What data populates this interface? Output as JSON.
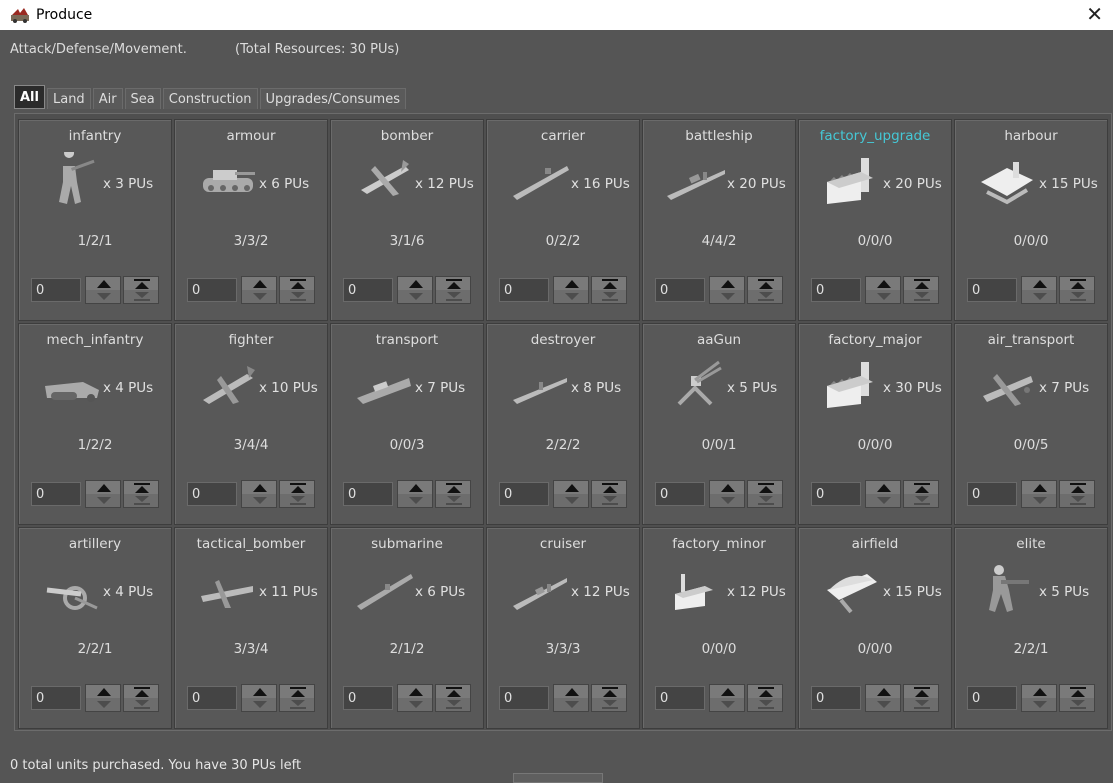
{
  "window": {
    "title": "Produce"
  },
  "header": {
    "info_label": "Attack/Defense/Movement.",
    "resources_label": "(Total Resources: 30 PUs)"
  },
  "tabs": [
    {
      "label": "All",
      "active": true
    },
    {
      "label": "Land"
    },
    {
      "label": "Air"
    },
    {
      "label": "Sea"
    },
    {
      "label": "Construction"
    },
    {
      "label": "Upgrades/Consumes"
    }
  ],
  "units": [
    {
      "name": "infantry",
      "cost": "x 3 PUs",
      "stats": "1/2/1",
      "qty": "0",
      "icon": "infantry-icon"
    },
    {
      "name": "armour",
      "cost": "x 6 PUs",
      "stats": "3/3/2",
      "qty": "0",
      "icon": "tank-icon"
    },
    {
      "name": "bomber",
      "cost": "x 12 PUs",
      "stats": "3/1/6",
      "qty": "0",
      "icon": "bomber-icon"
    },
    {
      "name": "carrier",
      "cost": "x 16 PUs",
      "stats": "0/2/2",
      "qty": "0",
      "icon": "carrier-icon"
    },
    {
      "name": "battleship",
      "cost": "x 20 PUs",
      "stats": "4/4/2",
      "qty": "0",
      "icon": "battleship-icon"
    },
    {
      "name": "factory_upgrade",
      "cost": "x 20 PUs",
      "stats": "0/0/0",
      "qty": "0",
      "icon": "factory-icon",
      "highlight": true
    },
    {
      "name": "harbour",
      "cost": "x 15 PUs",
      "stats": "0/0/0",
      "qty": "0",
      "icon": "harbour-icon"
    },
    {
      "name": "mech_infantry",
      "cost": "x 4 PUs",
      "stats": "1/2/2",
      "qty": "0",
      "icon": "halftrack-icon"
    },
    {
      "name": "fighter",
      "cost": "x 10 PUs",
      "stats": "3/4/4",
      "qty": "0",
      "icon": "fighter-icon"
    },
    {
      "name": "transport",
      "cost": "x 7 PUs",
      "stats": "0/0/3",
      "qty": "0",
      "icon": "transport-ship-icon"
    },
    {
      "name": "destroyer",
      "cost": "x 8 PUs",
      "stats": "2/2/2",
      "qty": "0",
      "icon": "destroyer-icon"
    },
    {
      "name": "aaGun",
      "cost": "x 5 PUs",
      "stats": "0/0/1",
      "qty": "0",
      "icon": "aa-gun-icon"
    },
    {
      "name": "factory_major",
      "cost": "x 30 PUs",
      "stats": "0/0/0",
      "qty": "0",
      "icon": "factory-icon"
    },
    {
      "name": "air_transport",
      "cost": "x 7 PUs",
      "stats": "0/0/5",
      "qty": "0",
      "icon": "air-transport-icon"
    },
    {
      "name": "artillery",
      "cost": "x 4 PUs",
      "stats": "2/2/1",
      "qty": "0",
      "icon": "artillery-icon"
    },
    {
      "name": "tactical_bomber",
      "cost": "x 11 PUs",
      "stats": "3/3/4",
      "qty": "0",
      "icon": "tactical-bomber-icon"
    },
    {
      "name": "submarine",
      "cost": "x 6 PUs",
      "stats": "2/1/2",
      "qty": "0",
      "icon": "submarine-icon"
    },
    {
      "name": "cruiser",
      "cost": "x 12 PUs",
      "stats": "3/3/3",
      "qty": "0",
      "icon": "cruiser-icon"
    },
    {
      "name": "factory_minor",
      "cost": "x 12 PUs",
      "stats": "0/0/0",
      "qty": "0",
      "icon": "small-factory-icon"
    },
    {
      "name": "airfield",
      "cost": "x 15 PUs",
      "stats": "0/0/0",
      "qty": "0",
      "icon": "airfield-icon"
    },
    {
      "name": "elite",
      "cost": "x 5 PUs",
      "stats": "2/2/1",
      "qty": "0",
      "icon": "elite-soldier-icon"
    }
  ],
  "footer": {
    "status": "0 total units purchased.  You have 30 PUs left"
  },
  "colors": {
    "highlight": "#45c8d6",
    "background": "#555555"
  }
}
